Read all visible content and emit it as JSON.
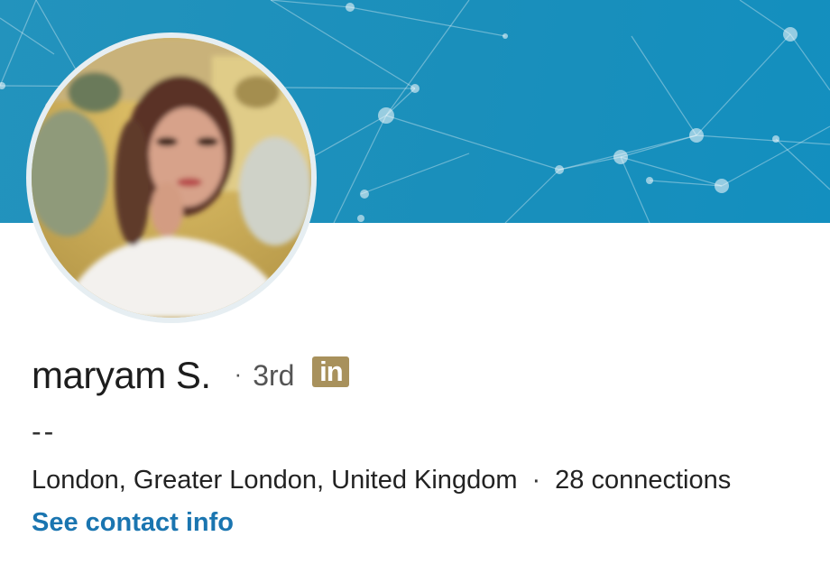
{
  "profile": {
    "name": "maryam S.",
    "separator": "·",
    "degree": "3rd",
    "premium_badge": "in",
    "headline": "--",
    "location": "London, Greater London, United Kingdom",
    "meta_separator": "·",
    "connections": "28 connections",
    "contact_link": "See contact info"
  },
  "colors": {
    "banner": "#1a8fbb",
    "link": "#1a75b0",
    "badge": "#a8915c"
  },
  "icons": {
    "avatar": "profile-photo",
    "badge": "linkedin-premium-icon",
    "banner": "network-pattern-background"
  }
}
